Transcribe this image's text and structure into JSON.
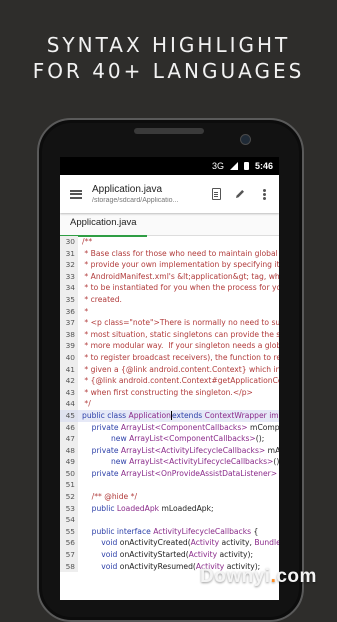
{
  "headline": {
    "line1": "SYNTAX HIGHLIGHT",
    "line2": "FOR 40+ LANGUAGES"
  },
  "status": {
    "network": "3G",
    "time": "5:46"
  },
  "appbar": {
    "menu_icon": "hamburger-menu-icon",
    "title": "Application.java",
    "path": "/storage/sdcard/Applicatio...",
    "icons": [
      "document-icon",
      "pencil-icon",
      "overflow-menu-icon"
    ]
  },
  "tab": {
    "label": "Application.java"
  },
  "code_lines": [
    {
      "num": "30",
      "segs": [
        {
          "t": "/**",
          "c": "c-comment"
        }
      ]
    },
    {
      "num": "31",
      "segs": [
        {
          "t": " * Base class for those who need to maintain global a",
          "c": "c-comment"
        }
      ]
    },
    {
      "num": "32",
      "segs": [
        {
          "t": " * provide your own implementation by specifying its",
          "c": "c-comment"
        }
      ]
    },
    {
      "num": "33",
      "segs": [
        {
          "t": " * AndroidManifest.xml's &lt;application&gt; tag, which",
          "c": "c-comment"
        }
      ]
    },
    {
      "num": "34",
      "segs": [
        {
          "t": " * to be instantiated for you when the process for you",
          "c": "c-comment"
        }
      ]
    },
    {
      "num": "35",
      "segs": [
        {
          "t": " * created.",
          "c": "c-comment"
        }
      ]
    },
    {
      "num": "36",
      "segs": [
        {
          "t": " *",
          "c": "c-comment"
        }
      ]
    },
    {
      "num": "37",
      "segs": [
        {
          "t": " * <p class=\"note\">There is normally no need to subc",
          "c": "c-comment"
        }
      ]
    },
    {
      "num": "38",
      "segs": [
        {
          "t": " * most situation, static singletons can provide the sa",
          "c": "c-comment"
        }
      ]
    },
    {
      "num": "39",
      "segs": [
        {
          "t": " * more modular way.  If your singleton needs a globa",
          "c": "c-comment"
        }
      ]
    },
    {
      "num": "40",
      "segs": [
        {
          "t": " * to register broadcast receivers), the function to retr",
          "c": "c-comment"
        }
      ]
    },
    {
      "num": "41",
      "segs": [
        {
          "t": " * given a {@link android.content.Context} which inter",
          "c": "c-comment"
        }
      ]
    },
    {
      "num": "42",
      "segs": [
        {
          "t": " * {@link android.content.Context#getApplicationCon",
          "c": "c-comment"
        }
      ]
    },
    {
      "num": "43",
      "segs": [
        {
          "t": " * when first constructing the singleton.</p>",
          "c": "c-comment"
        }
      ]
    },
    {
      "num": "44",
      "segs": [
        {
          "t": " */",
          "c": "c-comment"
        }
      ]
    },
    {
      "num": "45",
      "hl": true,
      "segs": [
        {
          "t": "public class ",
          "c": "c-kw"
        },
        {
          "t": "Application",
          "c": "c-type"
        },
        {
          "t": "|",
          "c": "cursor"
        },
        {
          "t": "extends ",
          "c": "c-kw"
        },
        {
          "t": "ContextWrapper imp",
          "c": "c-type"
        }
      ]
    },
    {
      "num": "46",
      "segs": [
        {
          "t": "    private ",
          "c": "c-kw"
        },
        {
          "t": "ArrayList<ComponentCallbacks>",
          "c": "c-type"
        },
        {
          "t": " mCompor",
          "c": "c-plain"
        }
      ]
    },
    {
      "num": "47",
      "segs": [
        {
          "t": "            new ",
          "c": "c-kw"
        },
        {
          "t": "ArrayList<ComponentCallbacks>",
          "c": "c-type"
        },
        {
          "t": "();",
          "c": "c-plain"
        }
      ]
    },
    {
      "num": "48",
      "segs": [
        {
          "t": "    private ",
          "c": "c-kw"
        },
        {
          "t": "ArrayList<ActivityLifecycleCallbacks>",
          "c": "c-type"
        },
        {
          "t": " mAct",
          "c": "c-plain"
        }
      ]
    },
    {
      "num": "49",
      "segs": [
        {
          "t": "            new ",
          "c": "c-kw"
        },
        {
          "t": "ArrayList<ActivityLifecycleCallbacks>",
          "c": "c-type"
        },
        {
          "t": "();",
          "c": "c-plain"
        }
      ]
    },
    {
      "num": "50",
      "segs": [
        {
          "t": "    private ",
          "c": "c-kw"
        },
        {
          "t": "ArrayList<OnProvideAssistDataListener>",
          "c": "c-type"
        },
        {
          "t": " mA",
          "c": "c-plain"
        }
      ]
    },
    {
      "num": "51",
      "segs": [
        {
          "t": "",
          "c": "c-plain"
        }
      ]
    },
    {
      "num": "52",
      "segs": [
        {
          "t": "    /** @hide */",
          "c": "c-comment"
        }
      ]
    },
    {
      "num": "53",
      "segs": [
        {
          "t": "    public ",
          "c": "c-kw"
        },
        {
          "t": "LoadedApk",
          "c": "c-type"
        },
        {
          "t": " mLoadedApk;",
          "c": "c-plain"
        }
      ]
    },
    {
      "num": "54",
      "segs": [
        {
          "t": "",
          "c": "c-plain"
        }
      ]
    },
    {
      "num": "55",
      "segs": [
        {
          "t": "    public interface ",
          "c": "c-kw"
        },
        {
          "t": "ActivityLifecycleCallbacks",
          "c": "c-type"
        },
        {
          "t": " {",
          "c": "c-plain"
        }
      ]
    },
    {
      "num": "56",
      "segs": [
        {
          "t": "        void ",
          "c": "c-kw"
        },
        {
          "t": "onActivityCreated(",
          "c": "c-plain"
        },
        {
          "t": "Activity",
          "c": "c-type"
        },
        {
          "t": " activity, ",
          "c": "c-plain"
        },
        {
          "t": "Bundle",
          "c": "c-type"
        },
        {
          "t": " s",
          "c": "c-plain"
        }
      ]
    },
    {
      "num": "57",
      "segs": [
        {
          "t": "        void ",
          "c": "c-kw"
        },
        {
          "t": "onActivityStarted(",
          "c": "c-plain"
        },
        {
          "t": "Activity",
          "c": "c-type"
        },
        {
          "t": " activity);",
          "c": "c-plain"
        }
      ]
    },
    {
      "num": "58",
      "segs": [
        {
          "t": "        void ",
          "c": "c-kw"
        },
        {
          "t": "onActivityResumed(",
          "c": "c-plain"
        },
        {
          "t": "Activity",
          "c": "c-type"
        },
        {
          "t": " activity);",
          "c": "c-plain"
        }
      ]
    }
  ],
  "watermark": {
    "text": "Downyi",
    "dot": ".",
    "tld": "com"
  },
  "colors": {
    "accent_tab": "#2f9e44",
    "comment": "#b13b3b",
    "keyword": "#2c3fa8",
    "type": "#8a2a8a",
    "highlight_line": "#e6e9f7"
  }
}
